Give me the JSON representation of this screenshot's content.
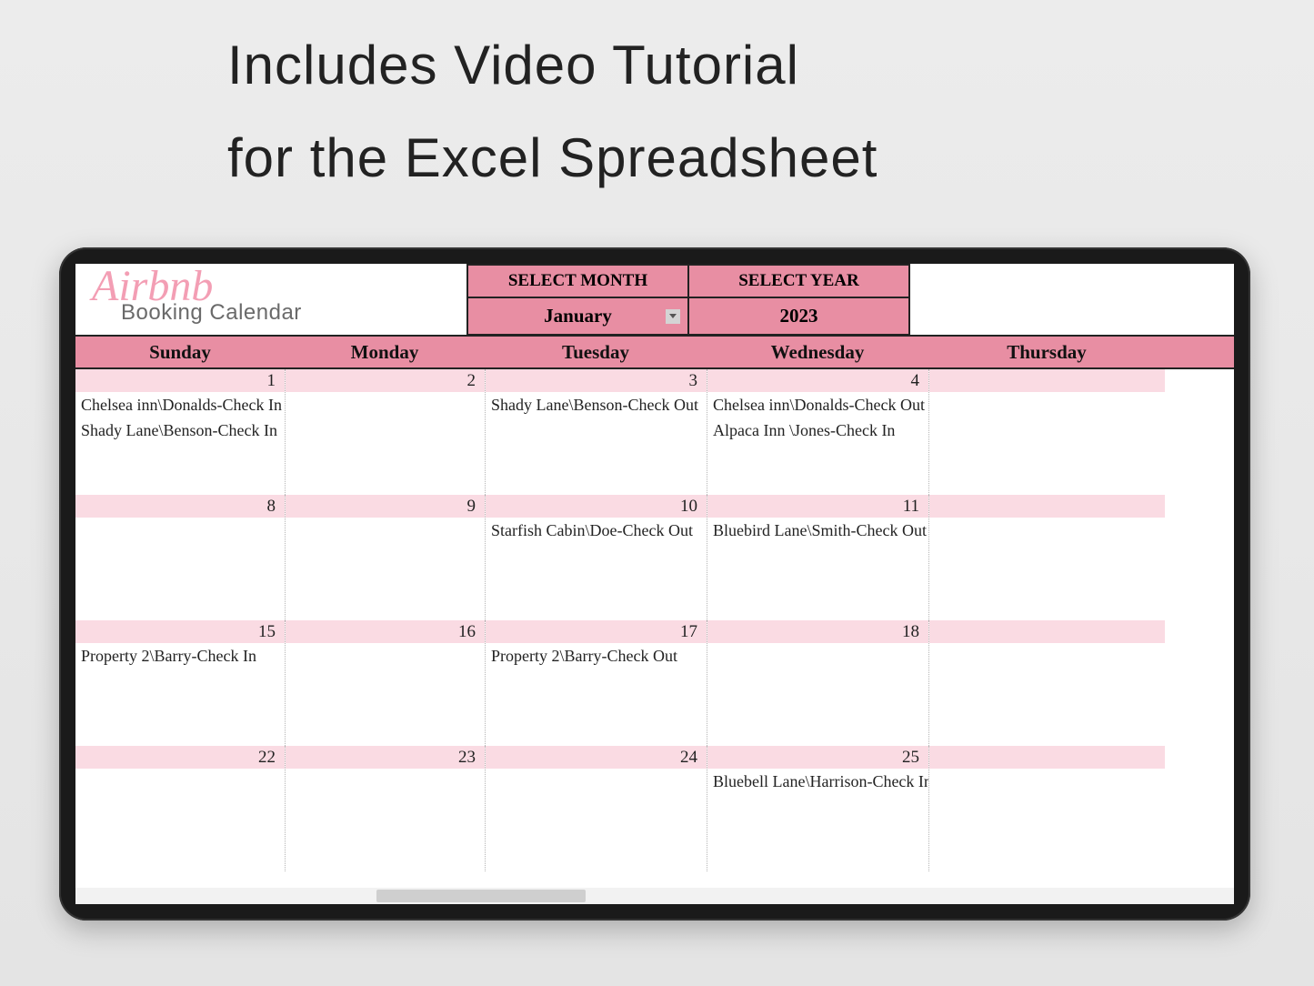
{
  "headline": {
    "line1": "Includes Video Tutorial",
    "line2": "for the Excel Spreadsheet"
  },
  "logo": {
    "script": "Airbnb",
    "sub": "Booking Calendar"
  },
  "selectors": {
    "month_label": "SELECT MONTH",
    "month_value": "January",
    "year_label": "SELECT YEAR",
    "year_value": "2023"
  },
  "day_headers": [
    "Sunday",
    "Monday",
    "Tuesday",
    "Wednesday",
    "Thursday"
  ],
  "weeks": [
    {
      "cells": [
        {
          "num": "1",
          "events": [
            "Chelsea inn\\Donalds-Check In",
            "Shady Lane\\Benson-Check In"
          ]
        },
        {
          "num": "2",
          "events": []
        },
        {
          "num": "3",
          "events": [
            "Shady Lane\\Benson-Check Out"
          ]
        },
        {
          "num": "4",
          "events": [
            "Chelsea inn\\Donalds-Check Out",
            "Alpaca Inn   \\Jones-Check In"
          ]
        },
        {
          "num": "",
          "events": []
        }
      ]
    },
    {
      "cells": [
        {
          "num": "8",
          "events": []
        },
        {
          "num": "9",
          "events": []
        },
        {
          "num": "10",
          "events": [
            "Starfish Cabin\\Doe-Check Out"
          ]
        },
        {
          "num": "11",
          "events": [
            "Bluebird Lane\\Smith-Check Out"
          ]
        },
        {
          "num": "",
          "events": []
        }
      ]
    },
    {
      "cells": [
        {
          "num": "15",
          "events": [
            "Property 2\\Barry-Check In"
          ]
        },
        {
          "num": "16",
          "events": []
        },
        {
          "num": "17",
          "events": [
            "Property 2\\Barry-Check Out"
          ]
        },
        {
          "num": "18",
          "events": []
        },
        {
          "num": "",
          "events": []
        }
      ]
    },
    {
      "cells": [
        {
          "num": "22",
          "events": []
        },
        {
          "num": "23",
          "events": []
        },
        {
          "num": "24",
          "events": []
        },
        {
          "num": "25",
          "events": [
            "Bluebell Lane\\Harrison-Check In"
          ]
        },
        {
          "num": "",
          "events": []
        }
      ]
    }
  ]
}
